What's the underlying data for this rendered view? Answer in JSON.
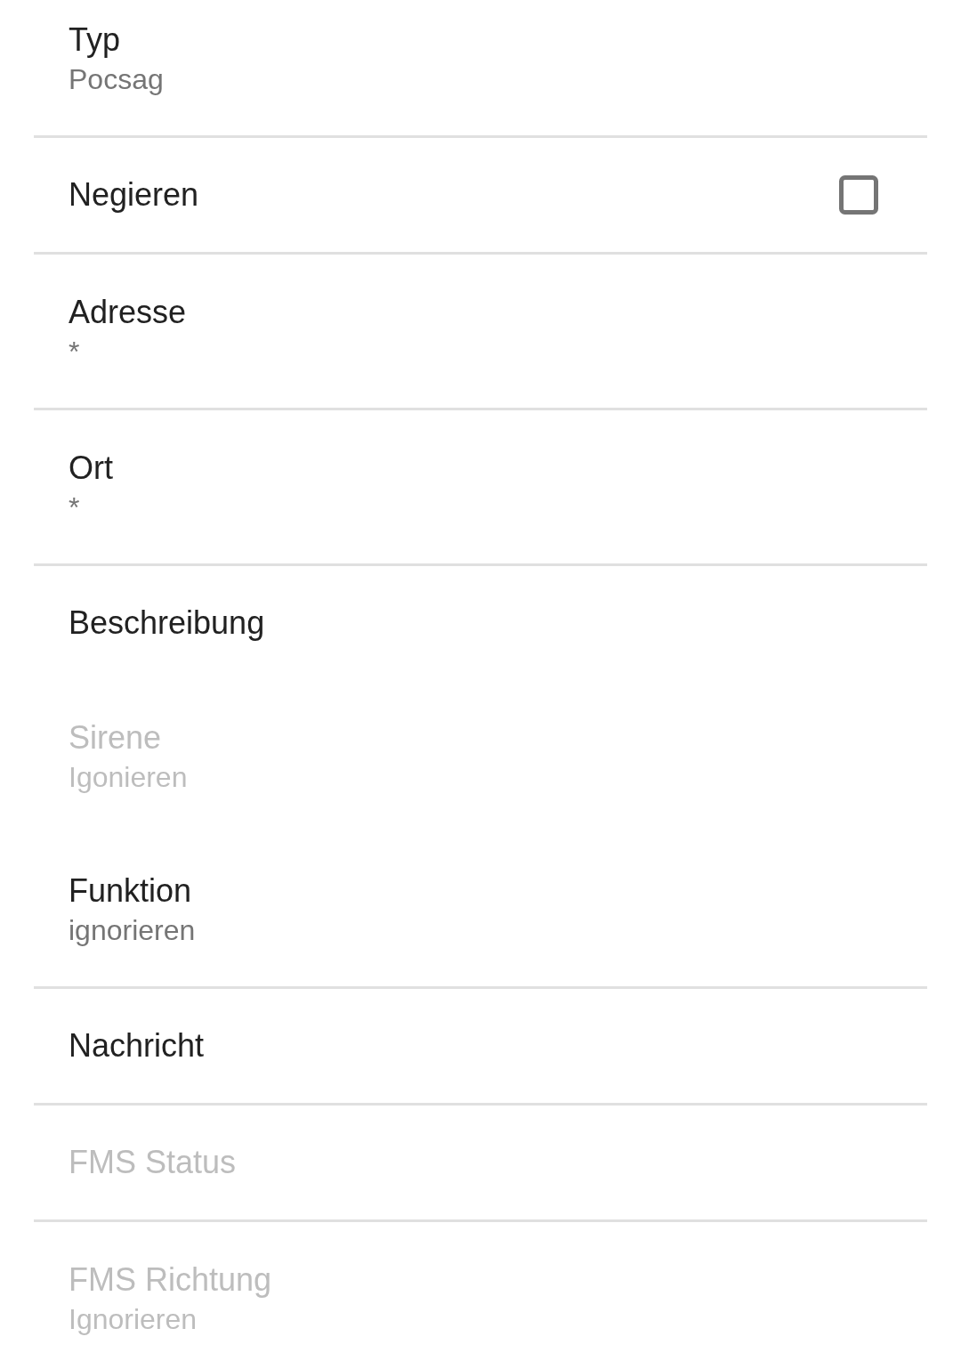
{
  "groups": [
    {
      "items": [
        {
          "kind": "text",
          "title": "Typ",
          "summary": "Pocsag",
          "disabled": false
        }
      ]
    },
    {
      "items": [
        {
          "kind": "checkbox",
          "title": "Negieren",
          "checked": false,
          "disabled": false
        }
      ]
    },
    {
      "items": [
        {
          "kind": "text",
          "title": "Adresse",
          "summary": "*",
          "disabled": false
        }
      ]
    },
    {
      "items": [
        {
          "kind": "text",
          "title": "Ort",
          "summary": "*",
          "disabled": false
        }
      ]
    },
    {
      "items": [
        {
          "kind": "text",
          "title": "Beschreibung",
          "disabled": false
        },
        {
          "kind": "text",
          "title": "Sirene",
          "summary": "Igonieren",
          "disabled": true
        },
        {
          "kind": "text",
          "title": "Funktion",
          "summary": "ignorieren",
          "disabled": false
        }
      ]
    },
    {
      "items": [
        {
          "kind": "text",
          "title": "Nachricht",
          "disabled": false
        }
      ]
    },
    {
      "items": [
        {
          "kind": "text",
          "title": "FMS Status",
          "disabled": true
        }
      ]
    },
    {
      "items": [
        {
          "kind": "text",
          "title": "FMS Richtung",
          "summary": "Ignorieren",
          "disabled": true
        }
      ]
    }
  ]
}
